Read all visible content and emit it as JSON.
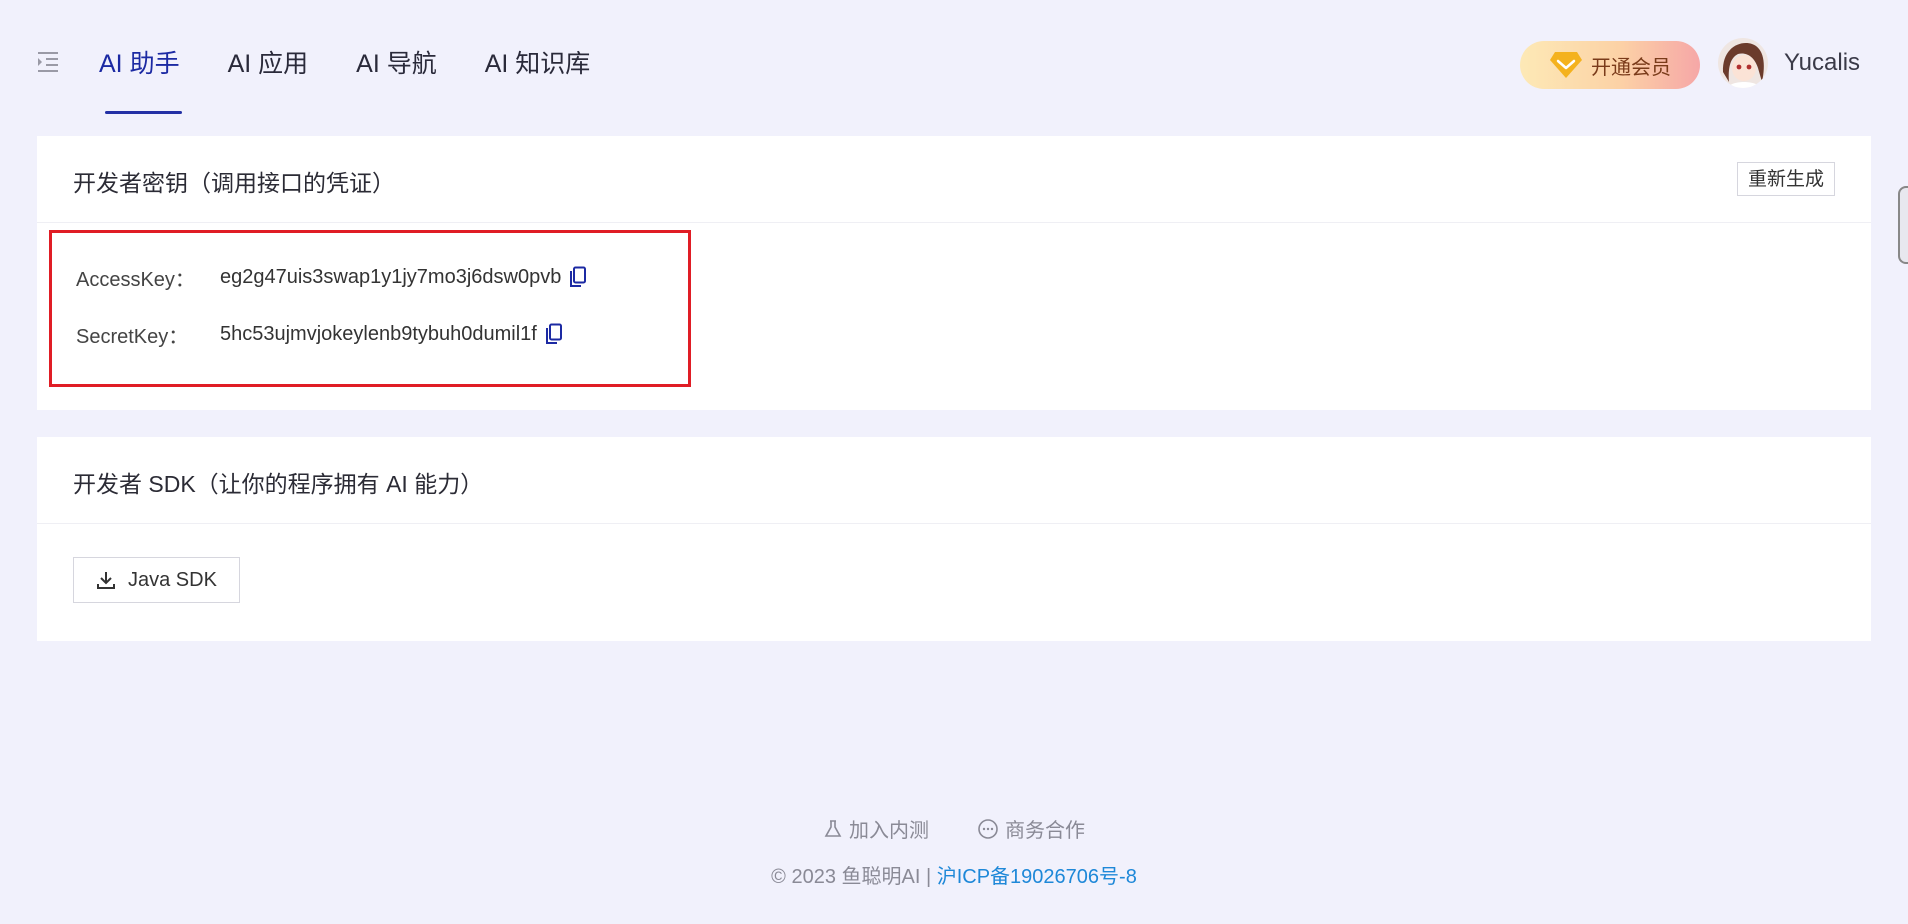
{
  "nav": {
    "items": [
      {
        "label": "AI 助手",
        "active": true
      },
      {
        "label": "AI 应用",
        "active": false
      },
      {
        "label": "AI 导航",
        "active": false
      },
      {
        "label": "AI 知识库",
        "active": false
      }
    ]
  },
  "header": {
    "vip_label": "开通会员",
    "username": "Yucalis"
  },
  "keys_card": {
    "title": "开发者密钥（调用接口的凭证）",
    "regenerate_label": "重新生成",
    "access_key_label": "AccessKey：",
    "access_key_value": "eg2g47uis3swap1y1jy7mo3j6dsw0pvb",
    "secret_key_label": "SecretKey：",
    "secret_key_value": "5hc53ujmvjokeylenb9tybuh0dumil1f"
  },
  "sdk_card": {
    "title": "开发者 SDK（让你的程序拥有 AI 能力）",
    "java_sdk_label": "Java SDK"
  },
  "footer": {
    "beta_label": "加入内测",
    "business_label": "商务合作",
    "copyright": "© 2023 鱼聪明AI | ",
    "icp": "沪ICP备19026706号-8"
  },
  "colors": {
    "accent": "#1c2aa3",
    "highlight_box": "#e01d25",
    "link": "#1e88d8"
  }
}
